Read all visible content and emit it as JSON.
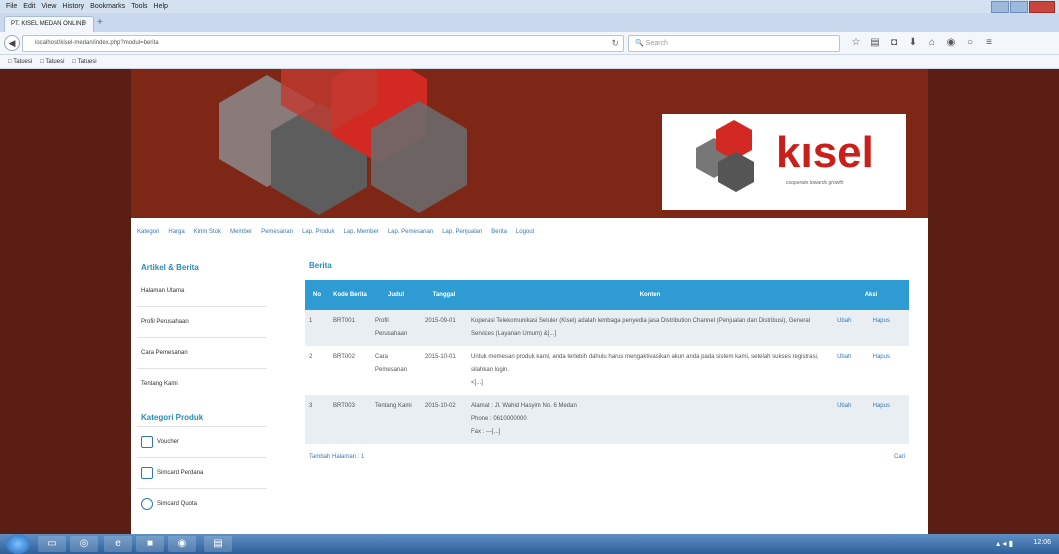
{
  "browser": {
    "menu": [
      "File",
      "Edit",
      "View",
      "History",
      "Bookmarks",
      "Tools",
      "Help"
    ],
    "tab_title": "PT. KISEL MEDAN ONLINE",
    "url": "localhost/kisel-medan/index.php?modul=berita",
    "search_placeholder": "Search",
    "bookmarks": [
      "Tatuesi",
      "Tatuesi",
      "Tatuesi"
    ]
  },
  "brand": {
    "logo_text": "kısel",
    "tagline": "cooperate towards growth"
  },
  "nav": [
    "Kategori",
    "Harga",
    "Kirim Stok",
    "Member",
    "Pemesanan",
    "Lap. Produk",
    "Lap. Member",
    "Lap. Pemesanan",
    "Lap. Penjualan",
    "Berita",
    "Logout"
  ],
  "sidebar": {
    "articles_title": "Artikel & Berita",
    "articles": [
      "Halaman Utama",
      "Profil Perusahaan",
      "Cara Pemesanan",
      "Tentang Kami"
    ],
    "categories_title": "Kategori Produk",
    "categories": [
      "Voucher",
      "Simcard Perdana",
      "Simcard Quota"
    ]
  },
  "main": {
    "title": "Berita",
    "columns": [
      "No",
      "Kode Berita",
      "Judul",
      "Tanggal",
      "Konten",
      "Aksi"
    ],
    "rows": [
      {
        "no": "1",
        "kode": "BRT001",
        "judul": "Profil Perusahaan",
        "tanggal": "2015-09-01",
        "konten": "Koperasi Telekomunikasi Seluler (Kisel) adalah lembaga penyedia jasa Distribution Channel (Penjualan dan Distribusi), General Services (Layanan Umum) &[...]",
        "ubah": "Ubah",
        "hapus": "Hapus"
      },
      {
        "no": "2",
        "kode": "BRT002",
        "judul": "Cara Pemesanan",
        "tanggal": "2015-10-01",
        "konten": "Untuk memesan produk kami, anda terlebih dahulu harus mengaktivasikan akun anda pada sistem kami, setelah sukses registrasi, silahkan login.",
        "konten_more": "<[...]",
        "ubah": "Ubah",
        "hapus": "Hapus"
      },
      {
        "no": "3",
        "kode": "BRT003",
        "judul": "Tentang Kami",
        "tanggal": "2015-10-02",
        "konten": "Alamat : Jl. Wahid Hasyim No. 6 Medan",
        "konten_phone": "Phone : 0610000000",
        "konten_fax": "Fax : ---[...]",
        "ubah": "Ubah",
        "hapus": "Hapus"
      }
    ],
    "footer_left": "Tambah  Halaman : 1",
    "footer_right": "Cari"
  },
  "taskbar": {
    "clock": "12:06"
  }
}
